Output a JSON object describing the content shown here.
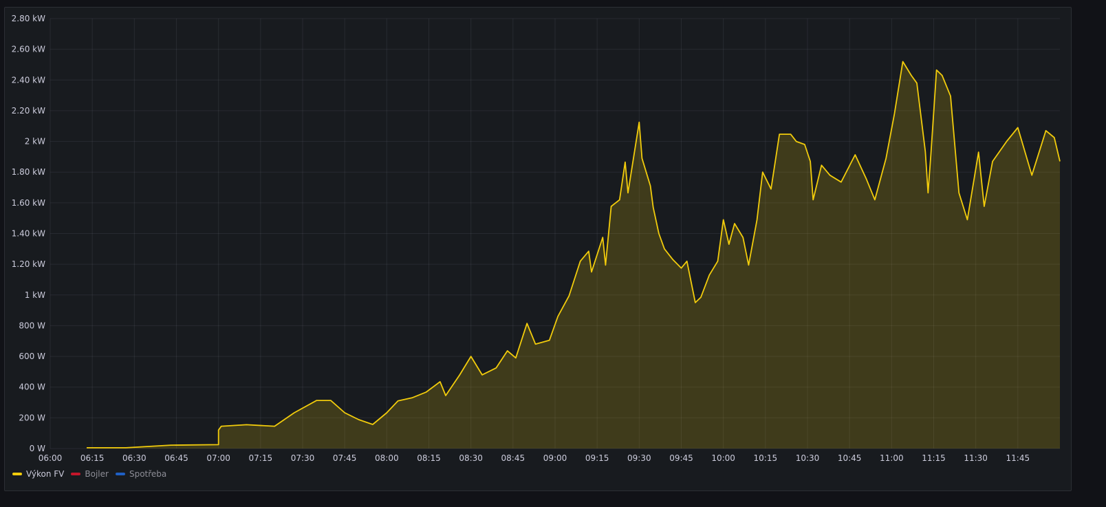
{
  "chart_data": {
    "type": "area",
    "title": "",
    "xlabel": "",
    "ylabel": "",
    "xlim": [
      "06:00",
      "12:00"
    ],
    "ylim": [
      0,
      2800
    ],
    "grid": true,
    "legend_placement": "bottom-left",
    "x_ticks": [
      "06:00",
      "06:15",
      "06:30",
      "06:45",
      "07:00",
      "07:15",
      "07:30",
      "07:45",
      "08:00",
      "08:15",
      "08:30",
      "08:45",
      "09:00",
      "09:15",
      "09:30",
      "09:45",
      "10:00",
      "10:15",
      "10:30",
      "10:45",
      "11:00",
      "11:15",
      "11:30",
      "11:45"
    ],
    "y_ticks": [
      {
        "value": 0,
        "label": "0 W"
      },
      {
        "value": 200,
        "label": "200 W"
      },
      {
        "value": 400,
        "label": "400 W"
      },
      {
        "value": 600,
        "label": "600 W"
      },
      {
        "value": 800,
        "label": "800 W"
      },
      {
        "value": 1000,
        "label": "1 kW"
      },
      {
        "value": 1200,
        "label": "1.20 kW"
      },
      {
        "value": 1400,
        "label": "1.40 kW"
      },
      {
        "value": 1600,
        "label": "1.60 kW"
      },
      {
        "value": 1800,
        "label": "1.80 kW"
      },
      {
        "value": 2000,
        "label": "2 kW"
      },
      {
        "value": 2200,
        "label": "2.20 kW"
      },
      {
        "value": 2400,
        "label": "2.40 kW"
      },
      {
        "value": 2600,
        "label": "2.60 kW"
      },
      {
        "value": 2800,
        "label": "2.80 kW"
      }
    ],
    "series": [
      {
        "name": "Výkon FV",
        "color": "#F2CC0C",
        "active": true,
        "x": [
          "06:13",
          "06:27",
          "06:43",
          "07:00",
          "07:00",
          "07:01",
          "07:10",
          "07:20",
          "07:27",
          "07:35",
          "07:40",
          "07:45",
          "07:50",
          "07:55",
          "08:00",
          "08:04",
          "08:09",
          "08:14",
          "08:19",
          "08:21",
          "08:26",
          "08:30",
          "08:34",
          "08:39",
          "08:43",
          "08:46",
          "08:50",
          "08:53",
          "08:58",
          "09:01",
          "09:05",
          "09:09",
          "09:12",
          "09:13",
          "09:17",
          "09:18",
          "09:20",
          "09:23",
          "09:25",
          "09:26",
          "09:30",
          "09:31",
          "09:34",
          "09:35",
          "09:37",
          "09:39",
          "09:42",
          "09:45",
          "09:47",
          "09:50",
          "09:52",
          "09:55",
          "09:58",
          "10:00",
          "10:02",
          "10:04",
          "10:07",
          "10:09",
          "10:12",
          "10:14",
          "10:17",
          "10:20",
          "10:24",
          "10:26",
          "10:29",
          "10:31",
          "10:32",
          "10:35",
          "10:38",
          "10:42",
          "10:47",
          "10:51",
          "10:54",
          "10:58",
          "11:01",
          "11:04",
          "11:07",
          "11:09",
          "11:12",
          "11:13",
          "11:14",
          "11:16",
          "11:18",
          "11:21",
          "11:24",
          "11:27",
          "11:31",
          "11:33",
          "11:36",
          "11:41",
          "11:45",
          "11:50",
          "11:55",
          "11:58",
          "12:00"
        ],
        "values": [
          5,
          5,
          22,
          25,
          120,
          145,
          155,
          145,
          233,
          313,
          313,
          233,
          188,
          157,
          233,
          310,
          330,
          367,
          435,
          345,
          480,
          600,
          480,
          525,
          636,
          590,
          815,
          680,
          705,
          860,
          995,
          1220,
          1285,
          1150,
          1375,
          1195,
          1577,
          1620,
          1865,
          1665,
          2125,
          1890,
          1710,
          1570,
          1400,
          1300,
          1230,
          1175,
          1220,
          950,
          985,
          1130,
          1220,
          1490,
          1330,
          1465,
          1375,
          1195,
          1490,
          1800,
          1690,
          2047,
          2047,
          2000,
          1980,
          1870,
          1620,
          1845,
          1780,
          1735,
          1913,
          1755,
          1620,
          1890,
          2180,
          2520,
          2430,
          2380,
          1935,
          1665,
          1915,
          2465,
          2430,
          2295,
          1665,
          1490,
          1930,
          1577,
          1870,
          2000,
          2090,
          1780,
          2070,
          2025,
          1870
        ]
      },
      {
        "name": "Bojler",
        "color": "#C4162A",
        "active": false,
        "x": [],
        "values": []
      },
      {
        "name": "Spotřeba",
        "color": "#1F60C4",
        "active": false,
        "x": [],
        "values": []
      }
    ]
  }
}
